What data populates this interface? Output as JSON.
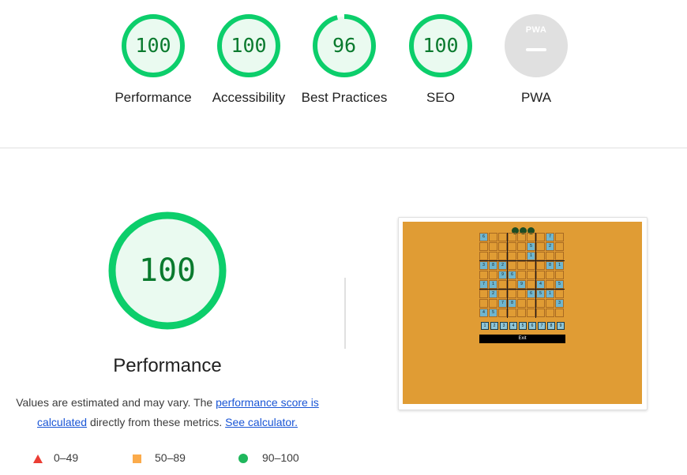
{
  "categories": [
    {
      "label": "Performance",
      "score": "100",
      "value": 100
    },
    {
      "label": "Accessibility",
      "score": "100",
      "value": 100
    },
    {
      "label": "Best Practices",
      "score": "96",
      "value": 96
    },
    {
      "label": "SEO",
      "score": "100",
      "value": 100
    },
    {
      "label": "PWA",
      "score": "",
      "badge": "PWA"
    }
  ],
  "performance": {
    "score": "100",
    "value": 100,
    "title": "Performance",
    "desc_prefix": "Values are estimated and may vary. The ",
    "link_score": "performance score is calculated",
    "desc_middle": " directly from these metrics. ",
    "link_calc": "See calculator."
  },
  "legend": {
    "fail": "0–49",
    "average": "50–89",
    "pass": "90–100"
  },
  "colors": {
    "pass": "#0cce6b",
    "pass_text": "#0a7a2e",
    "pass_fill": "#eafaf0",
    "fail": "#eb3d34",
    "average": "#fbab4b",
    "na": "#e0e0e0",
    "screenshot_bg": "#e09c34",
    "given_cell": "#6fb6cf"
  },
  "screenshot": {
    "grid": [
      [
        "6",
        "",
        "",
        "",
        "",
        "",
        "",
        "7",
        ""
      ],
      [
        "",
        "",
        "",
        "",
        "",
        "5",
        "",
        "2",
        ""
      ],
      [
        "",
        "",
        "",
        "",
        "",
        "1",
        "",
        "",
        ""
      ],
      [
        "3",
        "8",
        "2",
        "",
        "",
        "",
        "",
        "8",
        "1"
      ],
      [
        "",
        "",
        "9",
        "6",
        "",
        "",
        "",
        "",
        ""
      ],
      [
        "7",
        "1",
        "",
        "",
        "9",
        "",
        "4",
        "",
        "5"
      ],
      [
        "",
        "2",
        "",
        "",
        "",
        "6",
        "5",
        "1",
        ""
      ],
      [
        "",
        "",
        "7",
        "8",
        "",
        "",
        "",
        "",
        "3"
      ],
      [
        "4",
        "5",
        "",
        "",
        "",
        "",
        "",
        "",
        ""
      ]
    ],
    "number_bar": [
      "1",
      "2",
      "3",
      "4",
      "5",
      "6",
      "7",
      "8",
      "9"
    ],
    "exit_label": "Exit"
  }
}
